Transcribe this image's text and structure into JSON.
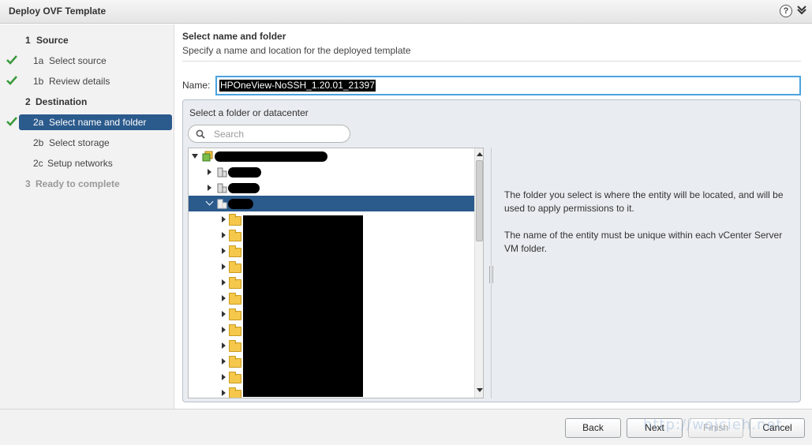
{
  "window": {
    "title": "Deploy OVF Template",
    "help": "?"
  },
  "steps": [
    {
      "num": "1",
      "label": "Source",
      "kind": "major",
      "done": false
    },
    {
      "num": "1a",
      "label": "Select source",
      "kind": "sub",
      "done": true
    },
    {
      "num": "1b",
      "label": "Review details",
      "kind": "sub",
      "done": true
    },
    {
      "num": "2",
      "label": "Destination",
      "kind": "major",
      "done": false
    },
    {
      "num": "2a",
      "label": "Select name and folder",
      "kind": "active",
      "done": true
    },
    {
      "num": "2b",
      "label": "Select storage",
      "kind": "sub",
      "done": false
    },
    {
      "num": "2c",
      "label": "Setup networks",
      "kind": "sub",
      "done": false
    },
    {
      "num": "3",
      "label": "Ready to complete",
      "kind": "disabled",
      "done": false
    }
  ],
  "main": {
    "title": "Select name and folder",
    "subtitle": "Specify a name and location for the deployed template",
    "name_label": "Name:",
    "name_value": "HPOneView-NoSSH_1.20.01_21397",
    "folder_label": "Select a folder or datacenter",
    "search_placeholder": "Search",
    "info": [
      "The folder you select is where the entity will be located, and will be used to apply permissions to it.",
      "The name of the entity must be unique within each vCenter Server VM folder."
    ]
  },
  "buttons": {
    "back": "Back",
    "next": "Next",
    "finish": "Finish",
    "cancel": "Cancel"
  },
  "watermark": "http://wojcieh.net",
  "colors": {
    "accent": "#2b5a8c",
    "check": "#3a9a3a",
    "input_focus": "#4aa3df"
  }
}
